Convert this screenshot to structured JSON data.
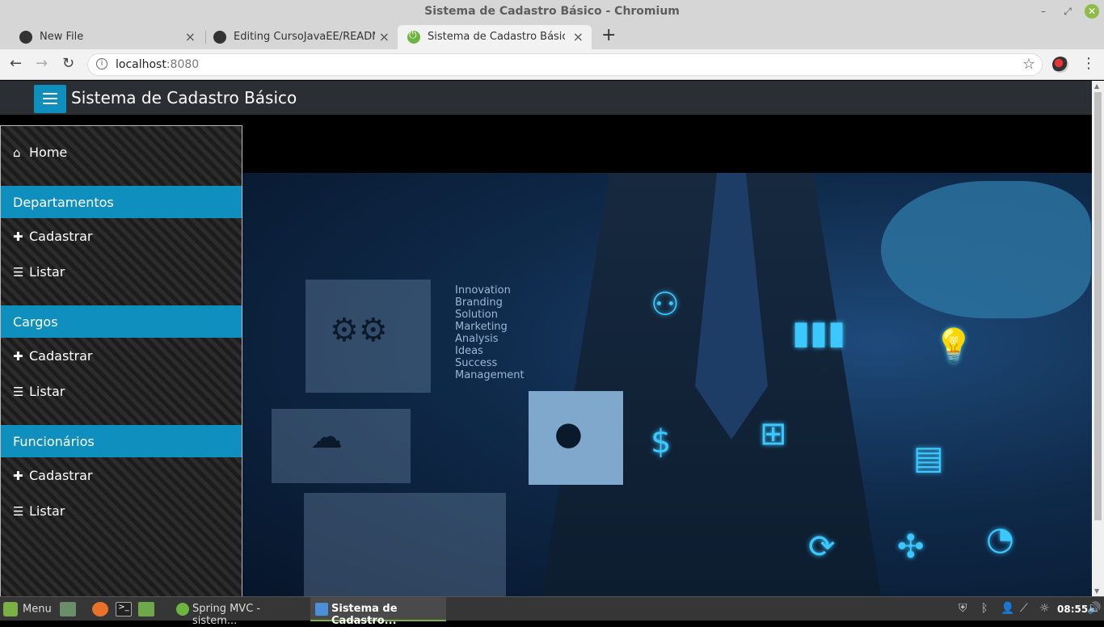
{
  "window": {
    "title": "Sistema de Cadastro Básico - Chromium"
  },
  "tabs": [
    {
      "label": "New File",
      "favicon": "github-icon"
    },
    {
      "label": "Editing CursoJavaEE/README.md",
      "favicon": "github-icon"
    },
    {
      "label": "Sistema de Cadastro Básico",
      "favicon": "spring-icon",
      "active": true
    }
  ],
  "address_bar": {
    "host": "localhost",
    "port": ":8080"
  },
  "app": {
    "brand": "Sistema de Cadastro Básico",
    "accent_color": "#0f8fbe"
  },
  "sidebar": {
    "home": "Home",
    "sections": [
      {
        "title": "Departamentos",
        "items": [
          {
            "label": "Cadastrar",
            "icon": "plus-icon"
          },
          {
            "label": "Listar",
            "icon": "table-list-icon"
          }
        ]
      },
      {
        "title": "Cargos",
        "items": [
          {
            "label": "Cadastrar",
            "icon": "plus-icon"
          },
          {
            "label": "Listar",
            "icon": "table-list-icon"
          }
        ]
      },
      {
        "title": "Funcionários",
        "items": [
          {
            "label": "Cadastrar",
            "icon": "plus-icon"
          },
          {
            "label": "Listar",
            "icon": "table-list-icon"
          }
        ]
      }
    ]
  },
  "hero": {
    "words": [
      "Innovation",
      "Branding",
      "Solution",
      "Marketing",
      "Analysis",
      "Ideas",
      "Success",
      "Management"
    ]
  },
  "taskbar": {
    "menu_label": "Menu",
    "windows": [
      {
        "label": "Spring MVC - sistem..."
      },
      {
        "label": "Sistema de Cadastro..."
      }
    ],
    "clock": "08:55"
  }
}
